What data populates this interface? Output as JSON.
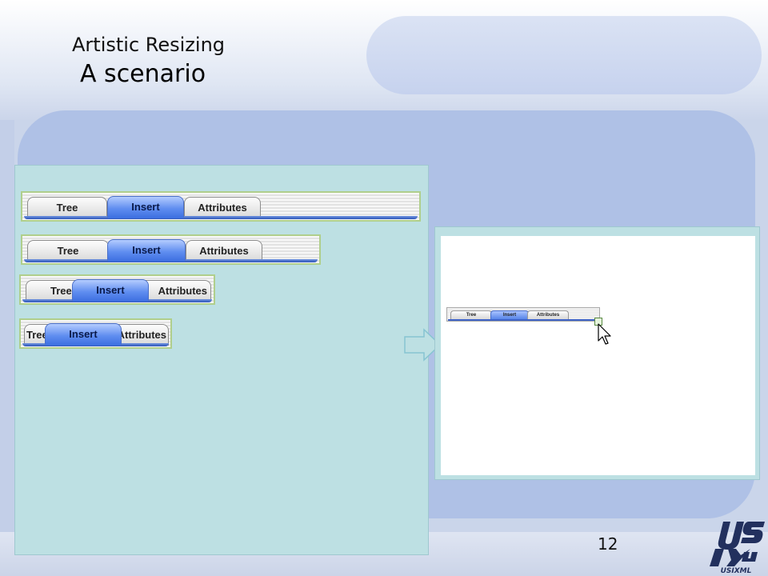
{
  "slide": {
    "title": "Artistic Resizing",
    "subtitle": "A scenario",
    "page_number": "12"
  },
  "tab_bars": [
    {
      "tabs": [
        {
          "label": "Tree"
        },
        {
          "label": "Insert",
          "active": true
        },
        {
          "label": "Attributes"
        }
      ]
    },
    {
      "tabs": [
        {
          "label": "Tree"
        },
        {
          "label": "Insert",
          "active": true
        },
        {
          "label": "Attributes"
        }
      ]
    },
    {
      "tabs": [
        {
          "label": "Tree"
        },
        {
          "label": "Insert",
          "active": true
        },
        {
          "label": "Attributes"
        }
      ]
    },
    {
      "tabs": [
        {
          "label": "Tree"
        },
        {
          "label": "Insert",
          "active": true
        },
        {
          "label": "Attributes"
        }
      ]
    }
  ],
  "preview": {
    "tabs": [
      {
        "label": "Tree"
      },
      {
        "label": "Insert",
        "active": true
      },
      {
        "label": "Attributes"
      }
    ]
  },
  "logo": {
    "text": "USIXML"
  },
  "icons": {
    "arrow": "right-arrow-icon",
    "cursor": "mouse-pointer-icon",
    "resize_handle": "resize-handle-icon"
  },
  "colors": {
    "panel": "#bde0e3",
    "active_tab": "#5f8df0",
    "tabbar_border": "#b0cf8c",
    "logo": "#22305e"
  }
}
